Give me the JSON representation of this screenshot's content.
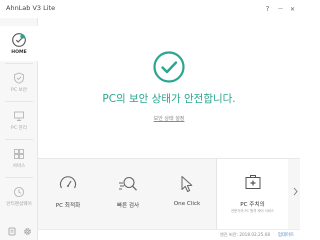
{
  "window": {
    "title": "AhnLab V3 Lite"
  },
  "titlebar_controls": [
    {
      "name": "help-button",
      "glyph": "?"
    },
    {
      "name": "minimize-button",
      "glyph": "—"
    },
    {
      "name": "close-button",
      "glyph": "✕"
    }
  ],
  "sidebar": {
    "items": [
      {
        "label": "HOME",
        "icon": "shield-check-icon",
        "active": true
      },
      {
        "label": "PC 보안",
        "icon": "shield-icon",
        "active": false
      },
      {
        "label": "PC 관리",
        "icon": "pc-manage-icon",
        "active": false
      },
      {
        "label": "서비스",
        "icon": "service-icon",
        "active": false
      },
      {
        "label": "안티랜섬웨어",
        "icon": "ransomware-icon",
        "active": false
      }
    ],
    "bottom_icons": [
      "notification-icon",
      "settings-icon"
    ]
  },
  "main": {
    "status_message": "PC의 보안 상태가 안전합니다.",
    "status_link": "보안 상태 설정",
    "status_color": "#2aa58f"
  },
  "tools": [
    {
      "label": "PC 최적화",
      "icon": "gauge-icon"
    },
    {
      "label": "빠른 검사",
      "icon": "quick-scan-icon"
    },
    {
      "label": "One Click",
      "icon": "cursor-icon"
    }
  ],
  "pc_care": {
    "label": "PC 주치의",
    "sublabel": "전문가의 PC 원격 케어 서비스",
    "icon": "medical-kit-icon"
  },
  "footer": {
    "engine_version": "엔진 버전: 2018.02.25.08",
    "update_label": "업데이트"
  }
}
